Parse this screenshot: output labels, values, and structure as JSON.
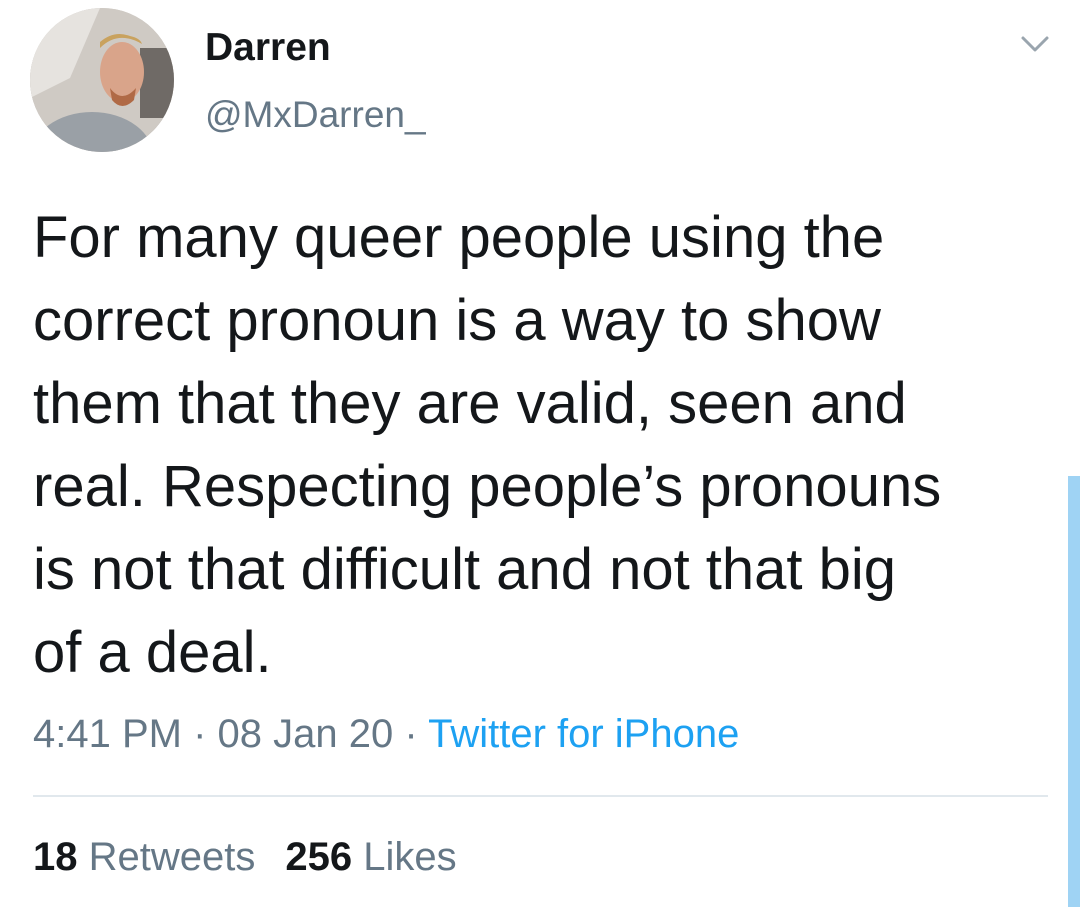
{
  "tweet": {
    "display_name": "Darren",
    "handle": "@MxDarren_",
    "text": "For many queer people using the\ncorrect pronoun is a way to show\nthem that they are valid, seen and\nreal. Respecting people’s pronouns\nis not that difficult and not that big\nof a deal.",
    "time": "4:41 PM",
    "separator": "·",
    "date": "08 Jan 20",
    "source": "Twitter for iPhone",
    "retweets_count": "18",
    "retweets_label": "Retweets",
    "likes_count": "256",
    "likes_label": "Likes"
  },
  "icons": {
    "menu": "chevron-down-icon",
    "avatar": "avatar"
  },
  "colors": {
    "text": "#14171a",
    "secondary": "#657786",
    "link": "#1da1f2",
    "divider": "#e1e8ed",
    "scroll_indicator": "#9fd3f4"
  }
}
